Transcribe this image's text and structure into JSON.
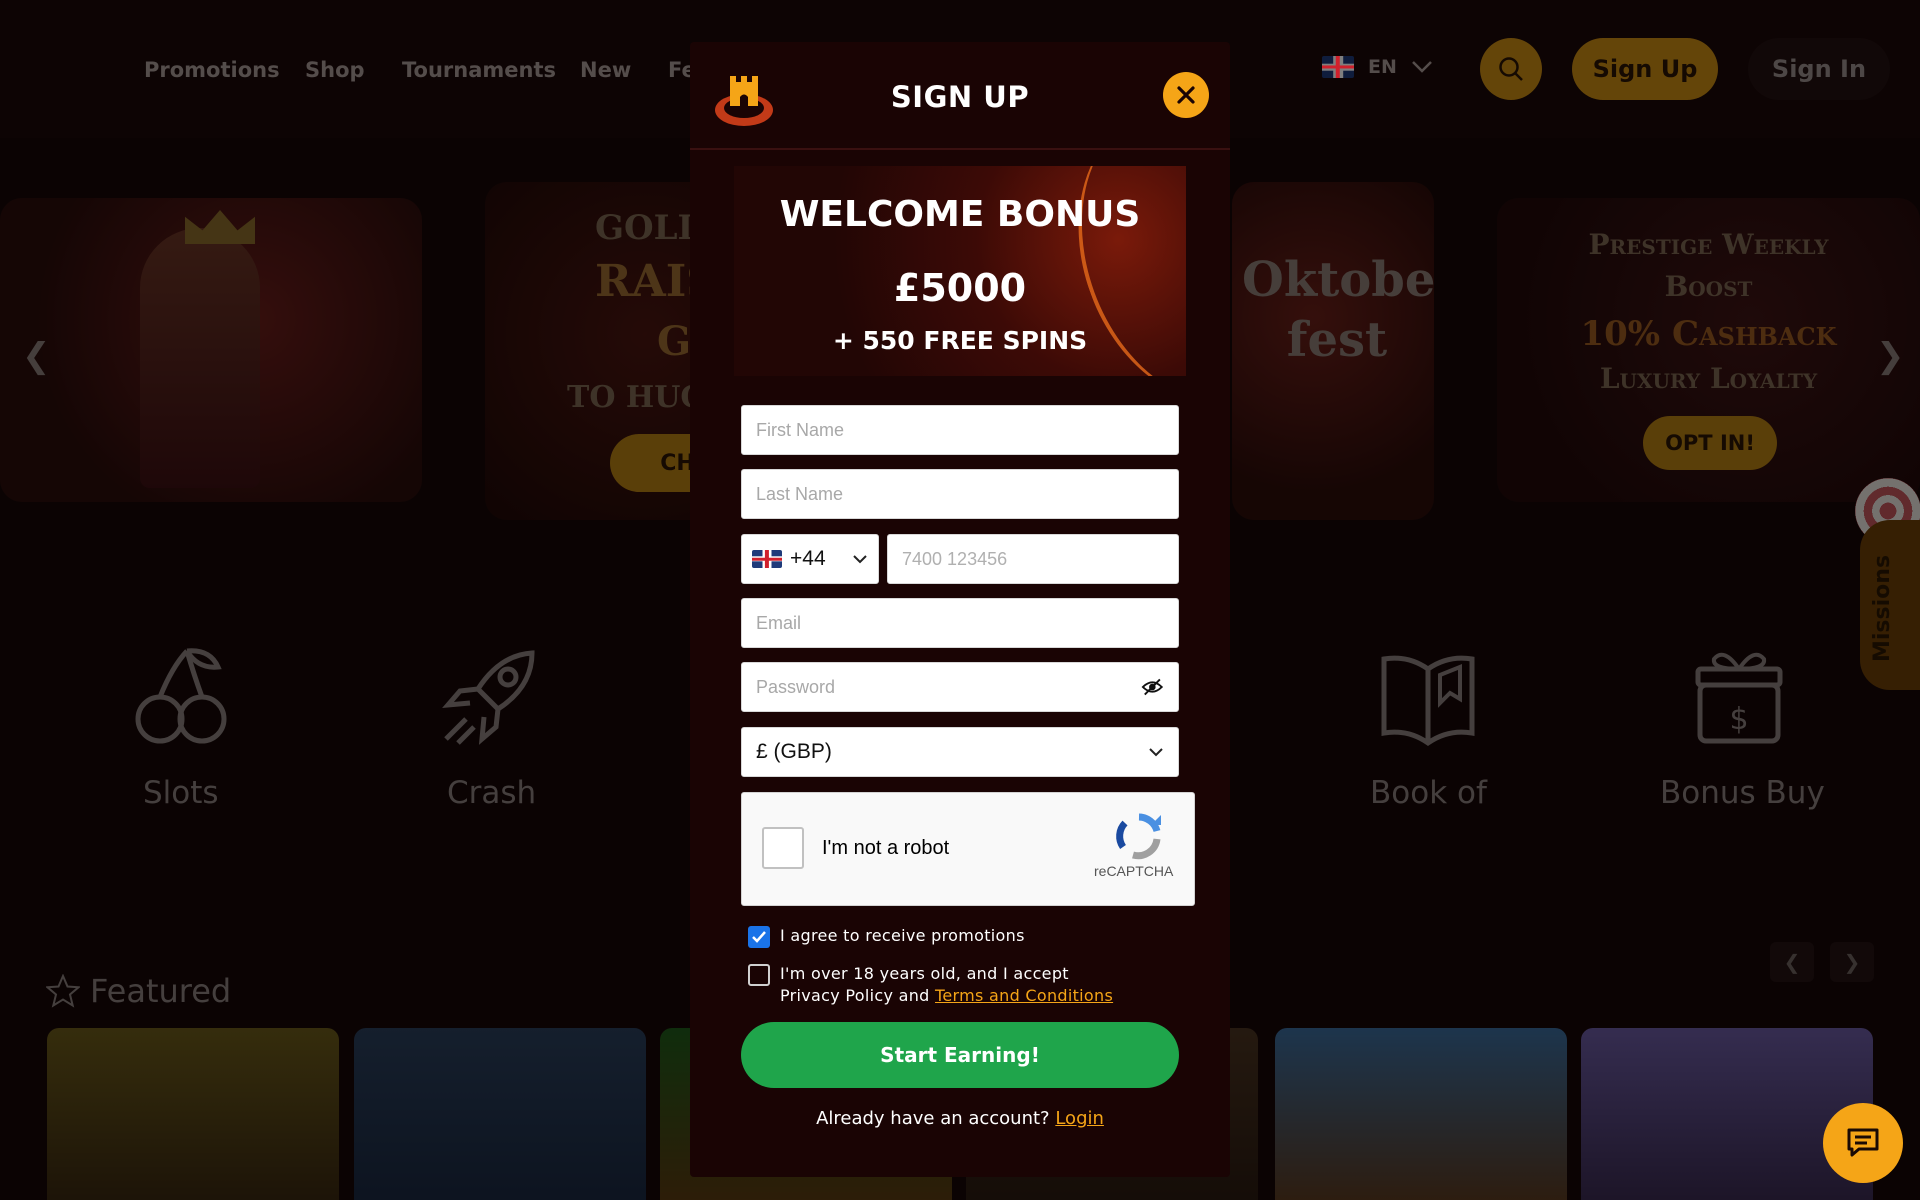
{
  "header": {
    "nav": [
      "Promotions",
      "Shop",
      "Tournaments",
      "New",
      "Fe"
    ],
    "language": "EN",
    "signup_label": "Sign Up",
    "signin_label": "Sign In"
  },
  "banners": {
    "b2_line1": "GOLD",
    "b2_line2": "RAIS",
    "b2_line3": "G",
    "b2_line4": "TO HUG",
    "b2_button": "CHE",
    "b3_text": "Oktober fest",
    "b4_line1": "Prestige Weekly",
    "b4_line2": "Boost",
    "b4_line3": "10% Cashback",
    "b4_line4": "Luxury Loyalty",
    "b4_button": "OPT IN!"
  },
  "missions_label": "Missions",
  "categories": [
    {
      "label": "Slots",
      "icon": "cherries-icon"
    },
    {
      "label": "Crash",
      "icon": "rocket-icon"
    },
    {
      "label": "Book of",
      "icon": "book-icon"
    },
    {
      "label": "Bonus Buy",
      "icon": "gift-money-icon"
    }
  ],
  "featured": {
    "title": "Featured",
    "icon": "star-icon"
  },
  "modal": {
    "title": "SIGN UP",
    "bonus_title": "WELCOME BONUS",
    "bonus_amount": "£5000",
    "bonus_spins": "+ 550 FREE SPINS",
    "first_name_placeholder": "First Name",
    "last_name_placeholder": "Last Name",
    "phone_code": "+44",
    "phone_placeholder": "7400 123456",
    "email_placeholder": "Email",
    "password_placeholder": "Password",
    "currency": "£ (GBP)",
    "captcha_text": "I'm not a robot",
    "captcha_brand": "reCAPTCHA",
    "agree_promotions": "I agree to receive promotions",
    "agree_promotions_checked": true,
    "age_line1": "I'm over 18 years old, and I accept",
    "age_line2_prefix": "Privacy Policy and ",
    "terms_link": "Terms and Conditions",
    "age_checked": false,
    "submit_label": "Start Earning!",
    "already_text": "Already have an account? ",
    "login_link": "Login"
  },
  "colors": {
    "accent": "#f5a517",
    "submit_green": "#1fa54b",
    "modal_bg": "#1a0404"
  }
}
